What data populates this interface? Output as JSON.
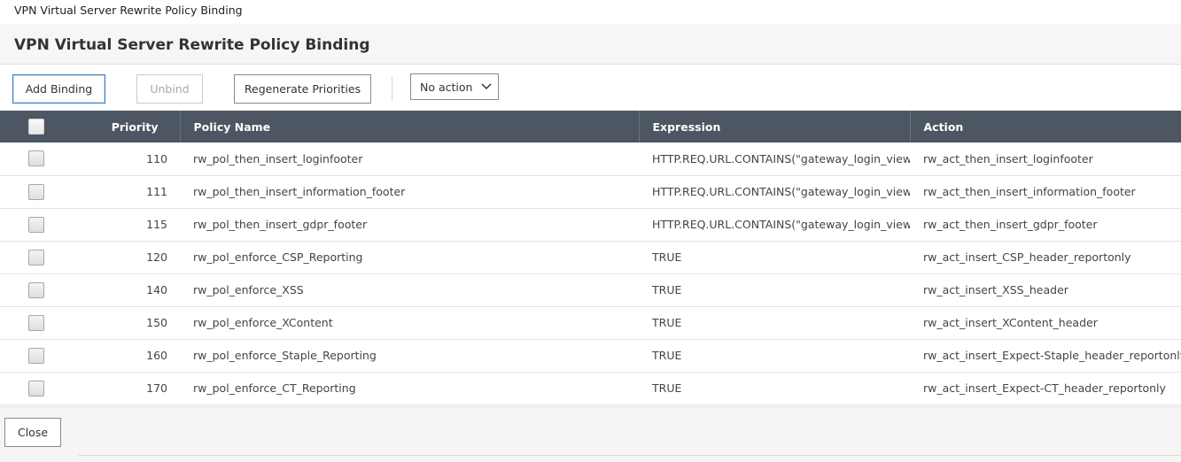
{
  "window": {
    "title": "VPN Virtual Server Rewrite Policy Binding"
  },
  "dialog": {
    "title": "VPN Virtual Server Rewrite Policy Binding"
  },
  "toolbar": {
    "add_label": "Add Binding",
    "unbind_label": "Unbind",
    "regenerate_label": "Regenerate Priorities",
    "action_select": {
      "selected": "No action"
    }
  },
  "table": {
    "columns": {
      "priority": "Priority",
      "policy_name": "Policy Name",
      "expression": "Expression",
      "action": "Action"
    },
    "rows": [
      {
        "priority": "110",
        "policy_name": "rw_pol_then_insert_loginfooter",
        "expression": "HTTP.REQ.URL.CONTAINS(\"gateway_login_view.js\")",
        "action": "rw_act_then_insert_loginfooter"
      },
      {
        "priority": "111",
        "policy_name": "rw_pol_then_insert_information_footer",
        "expression": "HTTP.REQ.URL.CONTAINS(\"gateway_login_view.js\")",
        "action": "rw_act_then_insert_information_footer"
      },
      {
        "priority": "115",
        "policy_name": "rw_pol_then_insert_gdpr_footer",
        "expression": "HTTP.REQ.URL.CONTAINS(\"gateway_login_view.js\")",
        "action": "rw_act_then_insert_gdpr_footer"
      },
      {
        "priority": "120",
        "policy_name": "rw_pol_enforce_CSP_Reporting",
        "expression": "TRUE",
        "action": "rw_act_insert_CSP_header_reportonly"
      },
      {
        "priority": "140",
        "policy_name": "rw_pol_enforce_XSS",
        "expression": "TRUE",
        "action": "rw_act_insert_XSS_header"
      },
      {
        "priority": "150",
        "policy_name": "rw_pol_enforce_XContent",
        "expression": "TRUE",
        "action": "rw_act_insert_XContent_header"
      },
      {
        "priority": "160",
        "policy_name": "rw_pol_enforce_Staple_Reporting",
        "expression": "TRUE",
        "action": "rw_act_insert_Expect-Staple_header_reportonly"
      },
      {
        "priority": "170",
        "policy_name": "rw_pol_enforce_CT_Reporting",
        "expression": "TRUE",
        "action": "rw_act_insert_Expect-CT_header_reportonly"
      }
    ]
  },
  "footer": {
    "close_label": "Close"
  },
  "icons": {
    "select_arrow": "chevron-down-icon",
    "row_select": "checkbox-icon"
  },
  "colors": {
    "header_bg": "#4d5663",
    "primary_border": "#3a7fc1",
    "disabled_text": "#a9a9a9"
  }
}
